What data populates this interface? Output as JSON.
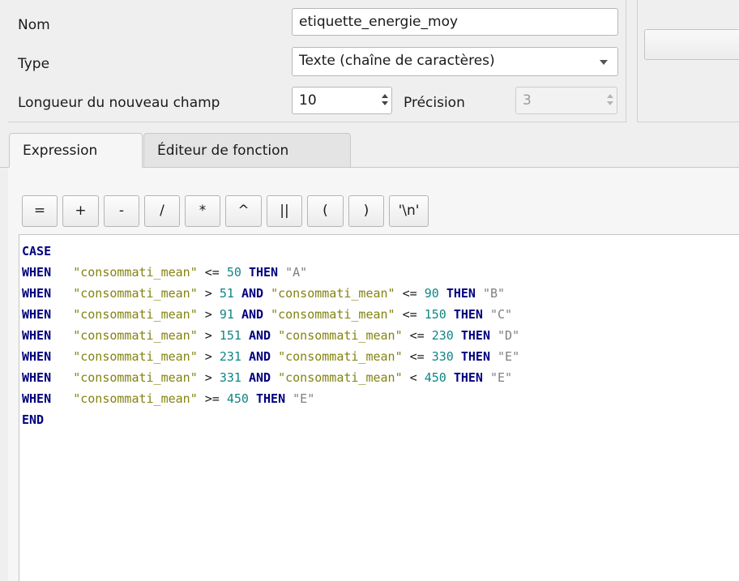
{
  "form": {
    "name_label": "Nom",
    "name_value": "etiquette_energie_moy",
    "type_label": "Type",
    "type_value": "Texte (chaîne de caractères)",
    "length_label": "Longueur du nouveau champ",
    "length_value": "10",
    "precision_label": "Précision",
    "precision_value": "3"
  },
  "tabs": [
    {
      "label": "Expression",
      "active": true
    },
    {
      "label": "Éditeur de fonction",
      "active": false
    }
  ],
  "operators": [
    "=",
    "+",
    "-",
    "/",
    "*",
    "^",
    "||",
    "(",
    ")",
    "'\\n'"
  ],
  "code": {
    "lines": [
      [
        {
          "t": "CASE",
          "c": "kw"
        }
      ],
      [
        {
          "t": "WHEN",
          "c": "kw"
        },
        {
          "t": "   ",
          "c": "op"
        },
        {
          "t": "\"consommati_mean\"",
          "c": "fld"
        },
        {
          "t": " <= ",
          "c": "op"
        },
        {
          "t": "50",
          "c": "num"
        },
        {
          "t": " ",
          "c": "op"
        },
        {
          "t": "THEN",
          "c": "kw"
        },
        {
          "t": " ",
          "c": "op"
        },
        {
          "t": "\"A\"",
          "c": "str"
        }
      ],
      [
        {
          "t": "WHEN",
          "c": "kw"
        },
        {
          "t": "   ",
          "c": "op"
        },
        {
          "t": "\"consommati_mean\"",
          "c": "fld"
        },
        {
          "t": " > ",
          "c": "op"
        },
        {
          "t": "51",
          "c": "num"
        },
        {
          "t": " ",
          "c": "op"
        },
        {
          "t": "AND",
          "c": "kw"
        },
        {
          "t": " ",
          "c": "op"
        },
        {
          "t": "\"consommati_mean\"",
          "c": "fld"
        },
        {
          "t": " <= ",
          "c": "op"
        },
        {
          "t": "90",
          "c": "num"
        },
        {
          "t": " ",
          "c": "op"
        },
        {
          "t": "THEN",
          "c": "kw"
        },
        {
          "t": " ",
          "c": "op"
        },
        {
          "t": "\"B\"",
          "c": "str"
        }
      ],
      [
        {
          "t": "WHEN",
          "c": "kw"
        },
        {
          "t": "   ",
          "c": "op"
        },
        {
          "t": "\"consommati_mean\"",
          "c": "fld"
        },
        {
          "t": " > ",
          "c": "op"
        },
        {
          "t": "91",
          "c": "num"
        },
        {
          "t": " ",
          "c": "op"
        },
        {
          "t": "AND",
          "c": "kw"
        },
        {
          "t": " ",
          "c": "op"
        },
        {
          "t": "\"consommati_mean\"",
          "c": "fld"
        },
        {
          "t": " <= ",
          "c": "op"
        },
        {
          "t": "150",
          "c": "num"
        },
        {
          "t": " ",
          "c": "op"
        },
        {
          "t": "THEN",
          "c": "kw"
        },
        {
          "t": " ",
          "c": "op"
        },
        {
          "t": "\"C\"",
          "c": "str"
        }
      ],
      [
        {
          "t": "WHEN",
          "c": "kw"
        },
        {
          "t": "   ",
          "c": "op"
        },
        {
          "t": "\"consommati_mean\"",
          "c": "fld"
        },
        {
          "t": " > ",
          "c": "op"
        },
        {
          "t": "151",
          "c": "num"
        },
        {
          "t": " ",
          "c": "op"
        },
        {
          "t": "AND",
          "c": "kw"
        },
        {
          "t": " ",
          "c": "op"
        },
        {
          "t": "\"consommati_mean\"",
          "c": "fld"
        },
        {
          "t": " <= ",
          "c": "op"
        },
        {
          "t": "230",
          "c": "num"
        },
        {
          "t": " ",
          "c": "op"
        },
        {
          "t": "THEN",
          "c": "kw"
        },
        {
          "t": " ",
          "c": "op"
        },
        {
          "t": "\"D\"",
          "c": "str"
        }
      ],
      [
        {
          "t": "WHEN",
          "c": "kw"
        },
        {
          "t": "   ",
          "c": "op"
        },
        {
          "t": "\"consommati_mean\"",
          "c": "fld"
        },
        {
          "t": " > ",
          "c": "op"
        },
        {
          "t": "231",
          "c": "num"
        },
        {
          "t": " ",
          "c": "op"
        },
        {
          "t": "AND",
          "c": "kw"
        },
        {
          "t": " ",
          "c": "op"
        },
        {
          "t": "\"consommati_mean\"",
          "c": "fld"
        },
        {
          "t": " <= ",
          "c": "op"
        },
        {
          "t": "330",
          "c": "num"
        },
        {
          "t": " ",
          "c": "op"
        },
        {
          "t": "THEN",
          "c": "kw"
        },
        {
          "t": " ",
          "c": "op"
        },
        {
          "t": "\"E\"",
          "c": "str"
        }
      ],
      [
        {
          "t": "WHEN",
          "c": "kw"
        },
        {
          "t": "   ",
          "c": "op"
        },
        {
          "t": "\"consommati_mean\"",
          "c": "fld"
        },
        {
          "t": " > ",
          "c": "op"
        },
        {
          "t": "331",
          "c": "num"
        },
        {
          "t": " ",
          "c": "op"
        },
        {
          "t": "AND",
          "c": "kw"
        },
        {
          "t": " ",
          "c": "op"
        },
        {
          "t": "\"consommati_mean\"",
          "c": "fld"
        },
        {
          "t": " < ",
          "c": "op"
        },
        {
          "t": "450",
          "c": "num"
        },
        {
          "t": " ",
          "c": "op"
        },
        {
          "t": "THEN",
          "c": "kw"
        },
        {
          "t": " ",
          "c": "op"
        },
        {
          "t": "\"E\"",
          "c": "str"
        }
      ],
      [
        {
          "t": "WHEN",
          "c": "kw"
        },
        {
          "t": "   ",
          "c": "op"
        },
        {
          "t": "\"consommati_mean\"",
          "c": "fld"
        },
        {
          "t": " >= ",
          "c": "op"
        },
        {
          "t": "450",
          "c": "num"
        },
        {
          "t": " ",
          "c": "op"
        },
        {
          "t": "THEN",
          "c": "kw"
        },
        {
          "t": " ",
          "c": "op"
        },
        {
          "t": "\"E\"",
          "c": "str"
        }
      ],
      [
        {
          "t": "END",
          "c": "kw"
        }
      ]
    ]
  },
  "icons": {
    "type_dropdown": "chevron-down-icon",
    "length_spinner": "spinner-arrows-icon",
    "precision_spinner": "spinner-arrows-icon"
  },
  "colors": {
    "keyword": "#00007f",
    "field": "#838311",
    "string": "#7f7f7f",
    "number": "#108585"
  }
}
